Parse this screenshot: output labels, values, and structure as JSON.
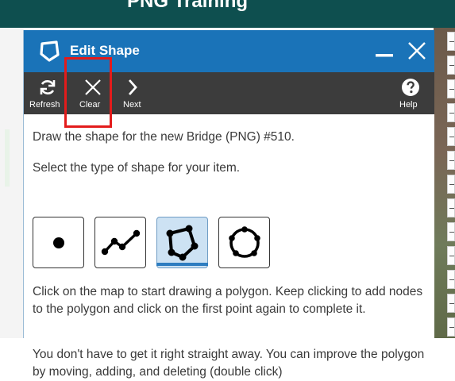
{
  "app": {
    "header_title": "PNG Training"
  },
  "dialog": {
    "title": "Edit Shape",
    "title_icon": "polygon-icon",
    "minimize_icon": "minimize-icon",
    "close_icon": "close-icon"
  },
  "toolbar": {
    "refresh_label": "Refresh",
    "clear_label": "Clear",
    "next_label": "Next",
    "help_label": "Help"
  },
  "content": {
    "instruction": "Draw the shape for the new Bridge (PNG) #510.",
    "select_prompt": "Select the type of shape for your item.",
    "shape_types": [
      "point",
      "line",
      "polygon",
      "circle"
    ],
    "selected_shape": "polygon",
    "polygon_help": "Click on the map to start drawing a polygon. Keep clicking to add nodes to the polygon and click on the first point again to complete it.",
    "improve_help": "You don't have to get it right straight away. You can improve the polygon by moving, adding, and deleting (double click)"
  },
  "colors": {
    "titlebar": "#1a73b8",
    "toolbar": "#3c3c3c",
    "header": "#0e4f4f",
    "highlight": "#e31b1b",
    "selected_shape_bg": "#cde2f3"
  }
}
